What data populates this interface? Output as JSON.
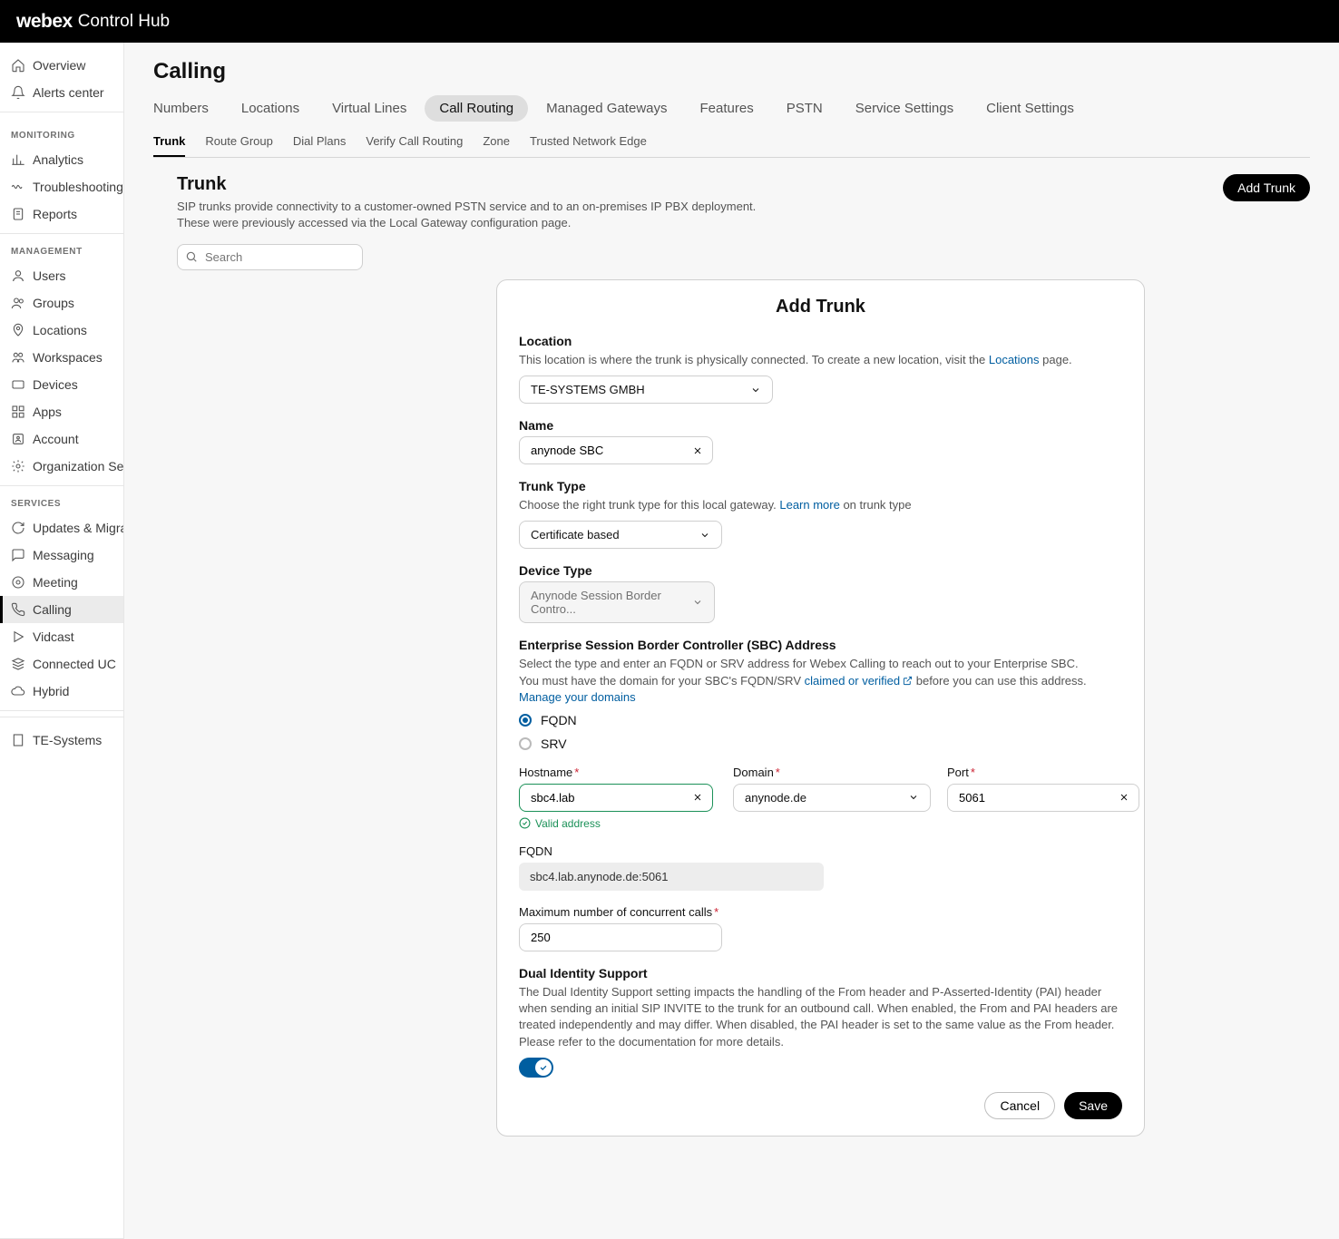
{
  "brand": {
    "name": "webex",
    "product": "Control Hub"
  },
  "sidebar": {
    "topItems": [
      {
        "label": "Overview",
        "icon": "home"
      },
      {
        "label": "Alerts center",
        "icon": "bell"
      }
    ],
    "sections": [
      {
        "header": "MONITORING",
        "items": [
          {
            "label": "Analytics",
            "icon": "chart"
          },
          {
            "label": "Troubleshooting",
            "icon": "wave"
          },
          {
            "label": "Reports",
            "icon": "doc"
          }
        ]
      },
      {
        "header": "MANAGEMENT",
        "items": [
          {
            "label": "Users",
            "icon": "user"
          },
          {
            "label": "Groups",
            "icon": "users"
          },
          {
            "label": "Locations",
            "icon": "pin"
          },
          {
            "label": "Workspaces",
            "icon": "workspace"
          },
          {
            "label": "Devices",
            "icon": "device"
          },
          {
            "label": "Apps",
            "icon": "apps"
          },
          {
            "label": "Account",
            "icon": "account"
          },
          {
            "label": "Organization Set...",
            "icon": "gear"
          }
        ]
      },
      {
        "header": "SERVICES",
        "items": [
          {
            "label": "Updates & Migra...",
            "icon": "refresh"
          },
          {
            "label": "Messaging",
            "icon": "message"
          },
          {
            "label": "Meeting",
            "icon": "meeting"
          },
          {
            "label": "Calling",
            "icon": "phone",
            "active": true
          },
          {
            "label": "Vidcast",
            "icon": "play"
          },
          {
            "label": "Connected UC",
            "icon": "stack"
          },
          {
            "label": "Hybrid",
            "icon": "cloud"
          }
        ]
      }
    ],
    "footerItem": {
      "label": "TE-Systems",
      "icon": "building"
    }
  },
  "page": {
    "title": "Calling",
    "primaryTabs": [
      "Numbers",
      "Locations",
      "Virtual Lines",
      "Call Routing",
      "Managed Gateways",
      "Features",
      "PSTN",
      "Service Settings",
      "Client Settings"
    ],
    "primaryActive": "Call Routing",
    "secondaryTabs": [
      "Trunk",
      "Route Group",
      "Dial Plans",
      "Verify Call Routing",
      "Zone",
      "Trusted Network Edge"
    ],
    "secondaryActive": "Trunk",
    "trunkHeader": {
      "title": "Trunk",
      "desc": "SIP trunks provide connectivity to a customer-owned PSTN service and to an on-premises IP PBX deployment. These were previously accessed via the Local Gateway configuration page.",
      "addBtn": "Add Trunk"
    },
    "searchPlaceholder": "Search"
  },
  "modal": {
    "title": "Add Trunk",
    "location": {
      "label": "Location",
      "helpPrefix": "This location is where the trunk is physically connected. To create a new location, visit the ",
      "linkText": "Locations",
      "helpSuffix": " page.",
      "value": "TE-SYSTEMS GMBH"
    },
    "name": {
      "label": "Name",
      "value": "anynode SBC"
    },
    "trunkType": {
      "label": "Trunk Type",
      "helpPrefix": "Choose the right trunk type for this local gateway. ",
      "linkText": "Learn more",
      "helpSuffix": " on trunk type",
      "value": "Certificate based"
    },
    "deviceType": {
      "label": "Device Type",
      "value": "Anynode Session Border Contro..."
    },
    "sbc": {
      "heading": "Enterprise Session Border Controller (SBC) Address",
      "line1": "Select the type and enter an FQDN or SRV address for Webex Calling to reach out to your Enterprise SBC.",
      "line2a": "You must have the domain for your SBC's FQDN/SRV ",
      "claimedLink": "claimed or verified",
      "line2b": " before you can use this address. ",
      "manageLink": "Manage your domains",
      "optFqdn": "FQDN",
      "optSrv": "SRV"
    },
    "hostname": {
      "label": "Hostname",
      "value": "sbc4.lab",
      "validMsg": "Valid address"
    },
    "domain": {
      "label": "Domain",
      "value": "anynode.de"
    },
    "port": {
      "label": "Port",
      "value": "5061"
    },
    "fqdn": {
      "label": "FQDN",
      "value": "sbc4.lab.anynode.de:5061"
    },
    "maxCalls": {
      "label": "Maximum number of concurrent calls",
      "value": "250"
    },
    "dual": {
      "label": "Dual Identity Support",
      "desc": "The Dual Identity Support setting impacts the handling of the From header and P-Asserted-Identity (PAI) header when sending an initial SIP INVITE to the trunk for an outbound call. When enabled, the From and PAI headers are treated independently and may differ. When disabled, the PAI header is set to the same value as the From header. Please refer to the documentation for more details."
    },
    "footer": {
      "cancel": "Cancel",
      "save": "Save"
    }
  }
}
